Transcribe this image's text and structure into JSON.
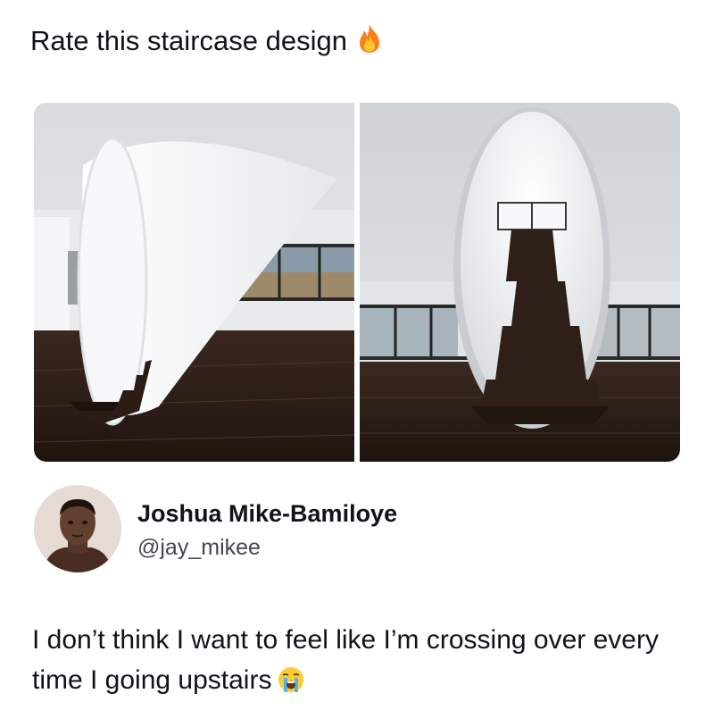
{
  "post": {
    "text": "Rate this staircase design",
    "text_emoji": "fire-emoji"
  },
  "images": [
    {
      "name": "staircase-side-view",
      "alt_icon": "photo"
    },
    {
      "name": "staircase-front-view",
      "alt_icon": "photo"
    }
  ],
  "reply": {
    "display_name": "Joshua Mike-Bamiloye",
    "handle": "@jay_mikee",
    "text": "I don’t think I want to feel like I’m crossing over every time I going upstairs",
    "text_emoji": "loudly-crying-face-emoji"
  },
  "colors": {
    "text": "#0f1419",
    "handle": "#404850",
    "floor": "#2a1c16",
    "wall": "#e4e6e8"
  }
}
